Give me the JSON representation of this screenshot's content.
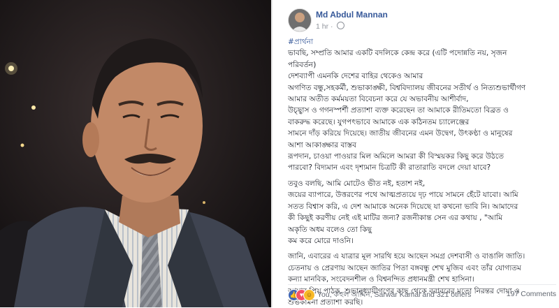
{
  "post": {
    "author": "Md Abdul Mannan",
    "time": "1 hr",
    "hashtag": "#প্রার্থনা",
    "paragraphs": [
      [
        "ভাবছি, সম্প্রতি আমার একটি বদলিকে কেন্দ্র করে (এটি পদোন্নতি নয়, সৃজন",
        "পরিবর্তন)",
        "দেশব্যাপী এমনকি দেশের বাহির থেকেও আমার",
        "অগণিত বন্ধু,সহকর্মী, শুভাকাঙ্ক্ষী, বিশ্ববিদ্যালয় জীবনের সতীর্থ ও নিত্যশুভার্থীগণ",
        "আমার অতীত কর্মময়তা বিবেচনা করে যে অভাবনীয় আশীর্বাদ,",
        "উচ্ছ্বাস ও গগনস্পর্শী প্রত্যাশা ব্যক্ত করেছেন তা আমাকে রীতিমতো বিব্রত ও",
        "বাকরুদ্ধ করেছে। যুগপৎভাবে আমাকে এক কঠিনতম চ্যালেঞ্জের",
        "সামনে দাঁড় করিয়ে দিয়েছে। জাতীয় জীবনের এমন উদ্বেগ, উৎকণ্ঠা ও মানুষের",
        "আশা আকাঙ্ক্ষার বাস্তব",
        "রূপদান, চাওয়া পাওয়ার মিল অমিলে আমরা কী বিস্ময়কর কিছু করে উঠতে",
        "পারবো? বিদ্যমান এবং দৃশ্যমান চিত্রটি কী রাতারাতি বদলে দেয়া যাবে?"
      ],
      [
        "তবুও বলছি, আমি মোটেও ভীত নই, হতাশ নই,",
        "জয়ের ব্যাপারে, উত্তরণের পথে আত্মপ্রত্যয়ে দৃঢ় পায়ে সামনে হেঁটে যাবো। আমি",
        "সতত বিশ্বাস করি, এ দেশ আমাকে অনেক দিয়েছে যা কখনো ভাবি নি। আমাদের",
        "কী কিছুই করণীয় নেই এই মাটির জন্য? রজনীকান্ত সেন এর কথায় , \"আমি",
        "অকৃতি অধম বলেও তো কিছু",
        "কম করে মোরে দাওনি।"
      ],
      [
        "জানি, এবারের এ যাত্রার মূল সারথি হয়ে আছেন সমগ্র দেশবাসী ও বাঙালি জাতি।",
        "চেতনায় ও প্রেরণায় আছেন জাতির পিতা বঙ্গবন্ধু শেখ মুজিব এবং তাঁর যোগ্যতম",
        "কন্যা মানবিক, সংবেদনশীল ও বিশ্বনন্দিত প্রধানমন্ত্রী শেখ হাসিনা।",
        "আমার প্রিয় পাঠক, শুভানুধ্যায়ীগণের কাছ থেকে বরাবরের মতো নিরন্তর দোয়া ও",
        "শুভকামনা প্রত্যাশা করছি।"
      ]
    ],
    "reactions_text": "You, কহুল আমিন, Sarwar Kamal and 321 others",
    "comments": "197 Comments"
  },
  "icons": {
    "globe": "globe-icon",
    "like": "like-reaction-icon",
    "love": "love-reaction-icon",
    "haha": "haha-reaction-icon"
  },
  "colors": {
    "author": "#365899",
    "hashtag": "#365899",
    "like": "#4267b2",
    "love": "#f25268",
    "haha": "#f7b928"
  }
}
